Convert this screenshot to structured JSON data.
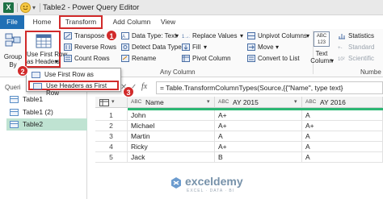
{
  "titlebar": {
    "app_icon": "X",
    "title": "Table2 - Power Query Editor"
  },
  "tabs": [
    {
      "label": "File"
    },
    {
      "label": "Home"
    },
    {
      "label": "Transform"
    },
    {
      "label": "Add Column"
    },
    {
      "label": "View"
    }
  ],
  "ribbon": {
    "group_by": [
      "Group",
      "By"
    ],
    "use_first_row": [
      "Use First Row",
      "as Headers"
    ],
    "transpose": "Transpose",
    "reverse_rows": "Reverse Rows",
    "count_rows": "Count Rows",
    "data_type": "Data Type: Text",
    "detect_data_type": "Detect Data Type",
    "rename": "Rename",
    "replace_values": "Replace Values",
    "fill": "Fill",
    "pivot_column": "Pivot Column",
    "unpivot_columns": "Unpivot Columns",
    "move": "Move",
    "convert_to_list": "Convert to List",
    "any_column_group": "Any Column",
    "text_column": [
      "Text",
      "Column"
    ],
    "text_column_icon": [
      "ABC",
      "123"
    ],
    "statistics": "Statistics",
    "standard": "Standard",
    "scientific": "Scientific",
    "number_group": "Numbe"
  },
  "dropdown": {
    "items": [
      "Use First Row as Headers",
      "Use Headers as First Row"
    ]
  },
  "badges": [
    "1",
    "2",
    "3"
  ],
  "queries": {
    "header": "Queri",
    "items": [
      "Table1",
      "Table1 (2)",
      "Table2"
    ]
  },
  "formula": {
    "fx": "fx",
    "text": "= Table.TransformColumnTypes(Source,{{\"Name\", type text}"
  },
  "grid": {
    "type_icons": [
      "ABC",
      "ABC"
    ],
    "columns": [
      "Name",
      "AY 2015",
      "AY 2016"
    ],
    "rows": [
      {
        "n": "1",
        "name": "John",
        "ay2015": "A+",
        "ay2016": "A"
      },
      {
        "n": "2",
        "name": "Michael",
        "ay2015": "A+",
        "ay2016": "A+"
      },
      {
        "n": "3",
        "name": "Martin",
        "ay2015": "A",
        "ay2016": "A"
      },
      {
        "n": "4",
        "name": "Ricky",
        "ay2015": "A+",
        "ay2016": "A"
      },
      {
        "n": "5",
        "name": "Jack",
        "ay2015": "B",
        "ay2016": "A"
      }
    ]
  },
  "watermark": {
    "brand": "exceldemy",
    "tagline": "EXCEL · DATA · BI"
  },
  "colors": {
    "accent_red": "#d12a2a",
    "file_tab_blue": "#1f6fb5",
    "excel_green": "#1e7145",
    "column_quality_green": "#2bb673"
  }
}
